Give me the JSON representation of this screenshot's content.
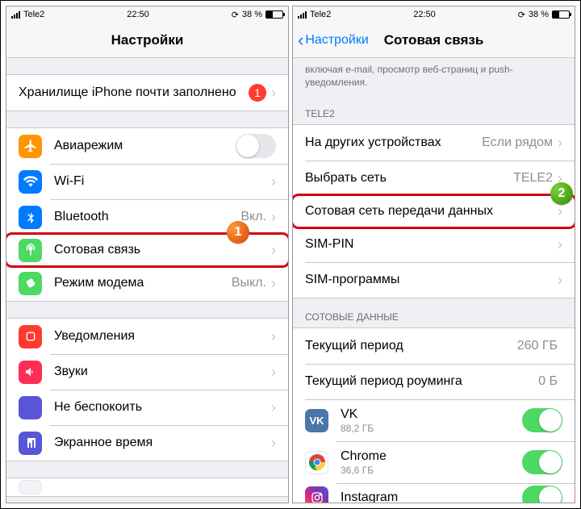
{
  "status": {
    "carrier": "Tele2",
    "time": "22:50",
    "battery": "38 %"
  },
  "colors": {
    "highlight": "#d00016"
  },
  "left": {
    "title": "Настройки",
    "storage": {
      "label": "Хранилище iPhone почти заполнено",
      "badge": "1"
    },
    "cells": {
      "airplane": {
        "label": "Авиарежим"
      },
      "wifi": {
        "label": "Wi-Fi",
        "value": ""
      },
      "bluetooth": {
        "label": "Bluetooth",
        "value": "Вкл."
      },
      "cellular": {
        "label": "Сотовая связь"
      },
      "hotspot": {
        "label": "Режим модема",
        "value": "Выкл."
      },
      "notifications": {
        "label": "Уведомления"
      },
      "sounds": {
        "label": "Звуки"
      },
      "dnd": {
        "label": "Не беспокоить"
      },
      "screentime": {
        "label": "Экранное время"
      }
    },
    "callout": "1"
  },
  "right": {
    "back": "Настройки",
    "title": "Сотовая связь",
    "footer_top": "включая e-mail, просмотр веб-страниц и push-уведомления.",
    "section_tele2": "TELE2",
    "cells": {
      "other": {
        "label": "На других устройствах",
        "value": "Если рядом"
      },
      "network": {
        "label": "Выбрать сеть",
        "value": "TELE2"
      },
      "apn": {
        "label": "Сотовая сеть передачи данных"
      },
      "simpin": {
        "label": "SIM-PIN"
      },
      "simapps": {
        "label": "SIM-программы"
      }
    },
    "section_data": "СОТОВЫЕ ДАННЫЕ",
    "usage": {
      "current": {
        "label": "Текущий период",
        "value": "260 ГБ"
      },
      "roaming": {
        "label": "Текущий период роуминга",
        "value": "0 Б"
      }
    },
    "apps": {
      "vk": {
        "label": "VK",
        "sub": "88,2 ГБ"
      },
      "chrome": {
        "label": "Chrome",
        "sub": "36,6 ГБ"
      },
      "insta": {
        "label": "Instagram",
        "sub": ""
      }
    },
    "callout": "2"
  }
}
